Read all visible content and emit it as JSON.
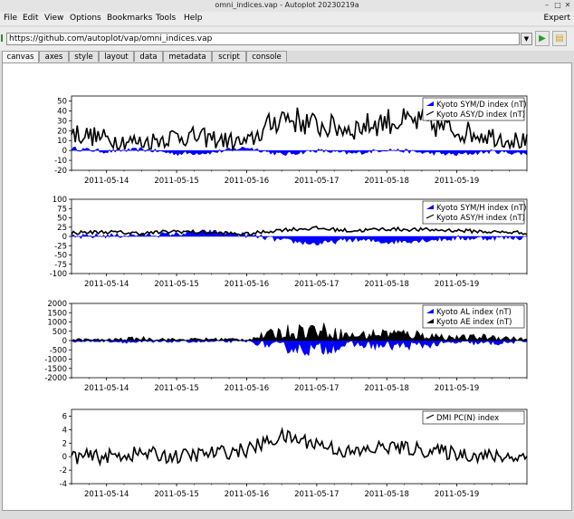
{
  "window": {
    "title": "omni_indices.vap - Autoplot 20230219a"
  },
  "menu": {
    "items": [
      "File",
      "Edit",
      "View",
      "Options",
      "Bookmarks",
      "Tools",
      "Help"
    ],
    "expert": "Expert"
  },
  "address": {
    "url": "https://github.com/autoplot/vap/omni_indices.vap"
  },
  "tabs": [
    "canvas",
    "axes",
    "style",
    "layout",
    "data",
    "metadata",
    "script",
    "console"
  ],
  "active_tab": "canvas",
  "colors": {
    "blue_series": "#0000ff",
    "black_series": "#000000"
  },
  "chart_data": [
    {
      "type": "line",
      "ylim": [
        -20,
        55
      ],
      "yticks": [
        -20,
        -10,
        0,
        10,
        20,
        30,
        40,
        50
      ],
      "x": [
        "2011-05-13T12:00",
        "2011-05-14T00:00",
        "2011-05-14T12:00",
        "2011-05-15T00:00",
        "2011-05-15T12:00",
        "2011-05-16T00:00",
        "2011-05-16T12:00",
        "2011-05-17T00:00",
        "2011-05-17T12:00",
        "2011-05-18T00:00",
        "2011-05-18T12:00",
        "2011-05-19T00:00",
        "2011-05-19T12:00",
        "2011-05-20T00:00"
      ],
      "xticks": [
        "2011-05-14",
        "2011-05-15",
        "2011-05-16",
        "2011-05-17",
        "2011-05-18",
        "2011-05-19"
      ],
      "series": [
        {
          "name": "Kyoto SYM/D index (nT)",
          "style": "fill",
          "color": "#0000ff",
          "values": [
            2,
            -1,
            1,
            -3,
            -2,
            3,
            -4,
            0,
            -3,
            1,
            -2,
            -4,
            -1,
            -3
          ]
        },
        {
          "name": "Kyoto ASY/D index (nT)",
          "style": "line",
          "color": "#000000",
          "values": [
            18,
            12,
            8,
            15,
            12,
            7,
            35,
            25,
            22,
            30,
            28,
            20,
            15,
            8
          ]
        }
      ]
    },
    {
      "type": "line",
      "ylim": [
        -100,
        100
      ],
      "yticks": [
        -100,
        -75,
        -50,
        -25,
        0,
        25,
        50,
        75,
        100
      ],
      "x": [
        "2011-05-13T12:00",
        "2011-05-14T00:00",
        "2011-05-14T12:00",
        "2011-05-15T00:00",
        "2011-05-15T12:00",
        "2011-05-16T00:00",
        "2011-05-16T12:00",
        "2011-05-17T00:00",
        "2011-05-17T12:00",
        "2011-05-18T00:00",
        "2011-05-18T12:00",
        "2011-05-19T00:00",
        "2011-05-19T12:00",
        "2011-05-20T00:00"
      ],
      "xticks": [
        "2011-05-14",
        "2011-05-15",
        "2011-05-16",
        "2011-05-17",
        "2011-05-18",
        "2011-05-19"
      ],
      "series": [
        {
          "name": "Kyoto SYM/H index (nT)",
          "style": "fill",
          "color": "#0000ff",
          "values": [
            -2,
            2,
            3,
            6,
            12,
            3,
            -10,
            -20,
            -8,
            -15,
            -10,
            -5,
            -4,
            -3
          ]
        },
        {
          "name": "Kyoto ASY/H index (nT)",
          "style": "line",
          "color": "#000000",
          "values": [
            10,
            12,
            8,
            14,
            10,
            6,
            18,
            22,
            15,
            20,
            18,
            16,
            12,
            10
          ]
        }
      ]
    },
    {
      "type": "line",
      "ylim": [
        -2000,
        2000
      ],
      "yticks": [
        -2000,
        -1500,
        -1000,
        -500,
        0,
        500,
        1000,
        1500,
        2000
      ],
      "x": [
        "2011-05-13T12:00",
        "2011-05-14T00:00",
        "2011-05-14T12:00",
        "2011-05-15T00:00",
        "2011-05-15T12:00",
        "2011-05-16T00:00",
        "2011-05-16T12:00",
        "2011-05-17T00:00",
        "2011-05-17T12:00",
        "2011-05-18T00:00",
        "2011-05-18T12:00",
        "2011-05-19T00:00",
        "2011-05-19T12:00",
        "2011-05-20T00:00"
      ],
      "xticks": [
        "2011-05-14",
        "2011-05-15",
        "2011-05-16",
        "2011-05-17",
        "2011-05-18",
        "2011-05-19"
      ],
      "series": [
        {
          "name": "Kyoto AL index (nT)",
          "style": "fill",
          "color": "#0000ff",
          "values": [
            -50,
            -30,
            -100,
            -40,
            -60,
            -40,
            -350,
            -500,
            -200,
            -300,
            -250,
            -100,
            -150,
            -40
          ]
        },
        {
          "name": "Kyoto AE index (nT)",
          "style": "fill",
          "color": "#000000",
          "values": [
            60,
            40,
            120,
            50,
            80,
            60,
            450,
            600,
            250,
            400,
            300,
            150,
            200,
            60
          ]
        }
      ]
    },
    {
      "type": "line",
      "ylim": [
        -4,
        7
      ],
      "yticks": [
        -4,
        -2,
        0,
        2,
        4,
        6
      ],
      "x": [
        "2011-05-13T12:00",
        "2011-05-14T00:00",
        "2011-05-14T12:00",
        "2011-05-15T00:00",
        "2011-05-15T12:00",
        "2011-05-16T00:00",
        "2011-05-16T12:00",
        "2011-05-17T00:00",
        "2011-05-17T12:00",
        "2011-05-18T00:00",
        "2011-05-18T12:00",
        "2011-05-19T00:00",
        "2011-05-19T12:00",
        "2011-05-20T00:00"
      ],
      "xticks": [
        "2011-05-14",
        "2011-05-15",
        "2011-05-16",
        "2011-05-17",
        "2011-05-18",
        "2011-05-19"
      ],
      "series": [
        {
          "name": "DMI PC(N) index",
          "style": "line",
          "color": "#000000",
          "values": [
            0,
            0,
            0.5,
            0,
            0.5,
            1,
            3,
            2,
            0.5,
            1.5,
            1,
            0.5,
            0,
            0
          ]
        }
      ]
    }
  ]
}
